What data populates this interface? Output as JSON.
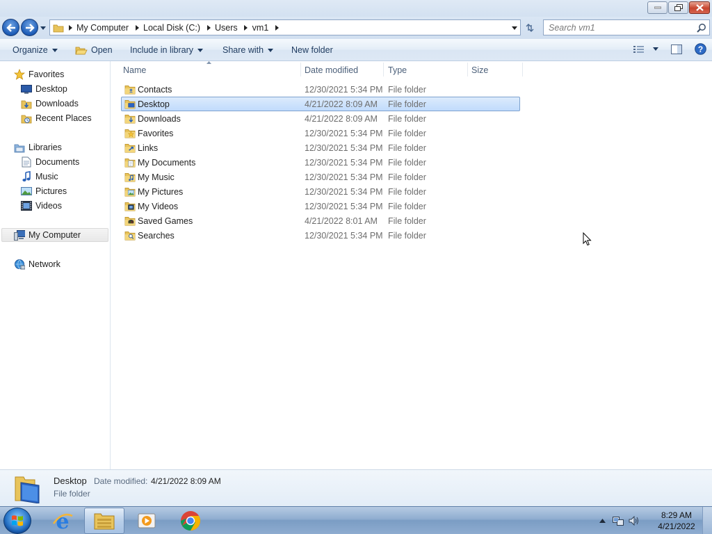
{
  "window": {
    "caption_buttons": [
      "minimize",
      "maximize",
      "close"
    ]
  },
  "address": {
    "breadcrumbs": [
      "My Computer",
      "Local Disk (C:)",
      "Users",
      "vm1"
    ],
    "search_placeholder": "Search vm1"
  },
  "toolbar": {
    "organize": "Organize",
    "open": "Open",
    "include_in_library": "Include in library",
    "share_with": "Share with",
    "new_folder": "New folder"
  },
  "nav": {
    "favorites": "Favorites",
    "desktop": "Desktop",
    "downloads": "Downloads",
    "recent_places": "Recent Places",
    "libraries": "Libraries",
    "documents": "Documents",
    "music": "Music",
    "pictures": "Pictures",
    "videos": "Videos",
    "my_computer": "My Computer",
    "network": "Network"
  },
  "columns": {
    "name": "Name",
    "date_modified": "Date modified",
    "type": "Type",
    "size": "Size"
  },
  "files": [
    {
      "name": "Contacts",
      "date": "12/30/2021 5:34 PM",
      "type": "File folder",
      "icon": "contacts-folder-icon"
    },
    {
      "name": "Desktop",
      "date": "4/21/2022 8:09 AM",
      "type": "File folder",
      "icon": "desktop-folder-icon",
      "selected": true
    },
    {
      "name": "Downloads",
      "date": "4/21/2022 8:09 AM",
      "type": "File folder",
      "icon": "downloads-folder-icon"
    },
    {
      "name": "Favorites",
      "date": "12/30/2021 5:34 PM",
      "type": "File folder",
      "icon": "favorites-folder-icon"
    },
    {
      "name": "Links",
      "date": "12/30/2021 5:34 PM",
      "type": "File folder",
      "icon": "links-folder-icon"
    },
    {
      "name": "My Documents",
      "date": "12/30/2021 5:34 PM",
      "type": "File folder",
      "icon": "documents-folder-icon"
    },
    {
      "name": "My Music",
      "date": "12/30/2021 5:34 PM",
      "type": "File folder",
      "icon": "music-folder-icon"
    },
    {
      "name": "My Pictures",
      "date": "12/30/2021 5:34 PM",
      "type": "File folder",
      "icon": "pictures-folder-icon"
    },
    {
      "name": "My Videos",
      "date": "12/30/2021 5:34 PM",
      "type": "File folder",
      "icon": "videos-folder-icon"
    },
    {
      "name": "Saved Games",
      "date": "4/21/2022 8:01 AM",
      "type": "File folder",
      "icon": "saved-games-folder-icon"
    },
    {
      "name": "Searches",
      "date": "12/30/2021 5:34 PM",
      "type": "File folder",
      "icon": "searches-folder-icon"
    }
  ],
  "details": {
    "name": "Desktop",
    "date_label": "Date modified:",
    "date_value": "4/21/2022 8:09 AM",
    "type": "File folder"
  },
  "taskbar": {
    "pinned": [
      "start-button",
      "internet-explorer-icon",
      "windows-explorer-icon",
      "media-player-icon",
      "chrome-icon"
    ],
    "active": "windows-explorer-icon",
    "clock_time": "8:29 AM",
    "clock_date": "4/21/2022"
  },
  "colors": {
    "selection_fill": "#c9dffc",
    "selection_border": "#7da2ce",
    "header_text": "#4c607a",
    "secondary_text": "#6d6d6d"
  }
}
